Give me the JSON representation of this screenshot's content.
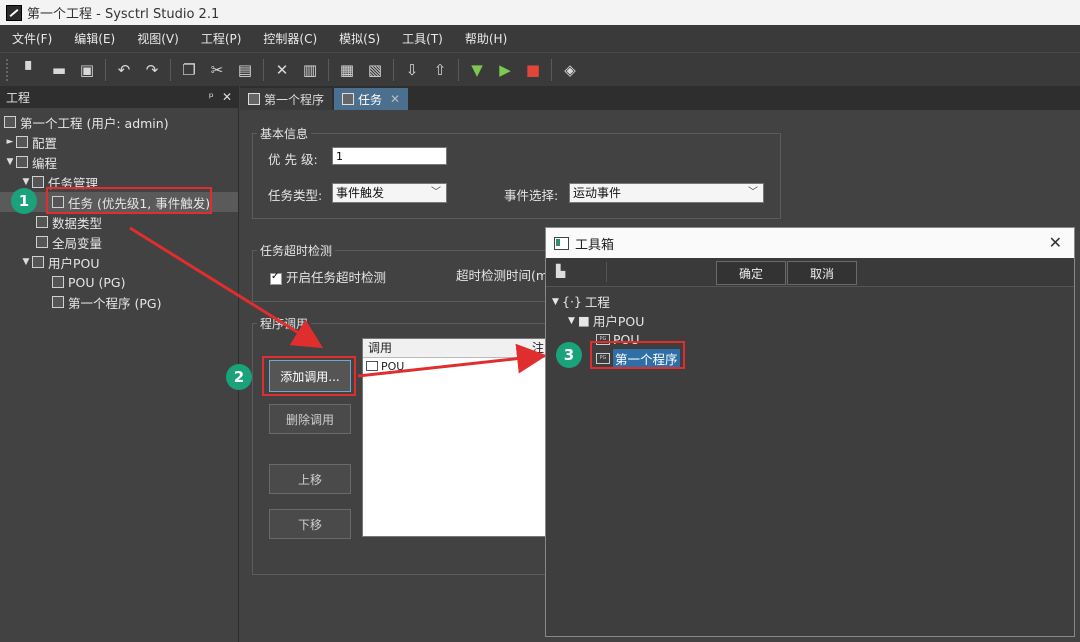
{
  "window": {
    "title": "第一个工程 - Sysctrl Studio 2.1"
  },
  "menu": [
    "文件(F)",
    "编辑(E)",
    "视图(V)",
    "工程(P)",
    "控制器(C)",
    "模拟(S)",
    "工具(T)",
    "帮助(H)"
  ],
  "toolbar": {
    "icons": [
      "new-file-icon",
      "open-folder-icon",
      "save-icon",
      "undo-icon",
      "redo-icon",
      "copy-icon",
      "cut-icon",
      "paste-icon",
      "delete-icon",
      "properties-icon",
      "compile-icon",
      "clear-icon",
      "download-icon",
      "upload-icon",
      "connect-icon",
      "run-icon",
      "stop-icon",
      "debug-icon"
    ]
  },
  "left_panel": {
    "title": "工程",
    "pin": "ᵖ",
    "close": "✕",
    "tree": {
      "root": "第一个工程 (用户: admin)",
      "config": "配置",
      "program": "编程",
      "task_mgmt": "任务管理",
      "task": "任务 (优先级1, 事件触发)",
      "datatype": "数据类型",
      "globals": "全局变量",
      "user_pou": "用户POU",
      "pou": "POU (PG)",
      "first_prog": "第一个程序 (PG)"
    }
  },
  "tabs": [
    {
      "label": "第一个程序"
    },
    {
      "label": "任务",
      "close": "✕"
    }
  ],
  "basic_info": {
    "legend": "基本信息",
    "priority_label": "优 先 级:",
    "priority_value": "1",
    "task_type_label": "任务类型:",
    "task_type_value": "事件触发",
    "event_label": "事件选择:",
    "event_value": "运动事件"
  },
  "timeout": {
    "legend": "任务超时检测",
    "enable_label": "开启任务超时检测",
    "time_label": "超时检测时间(m"
  },
  "program_call": {
    "legend": "程序调用",
    "add_button": "添加调用...",
    "delete_button": "删除调用",
    "up_button": "上移",
    "down_button": "下移",
    "list_header": "调用",
    "list_header2": "注",
    "list_item": "POU"
  },
  "dialog": {
    "title": "工具箱",
    "close": "✕",
    "ok": "确定",
    "cancel": "取消",
    "tree": {
      "project": "工程",
      "user_pou": "用户POU",
      "pou": "POU",
      "first_prog": "第一个程序"
    }
  },
  "annotations": {
    "step1": "1",
    "step2": "2",
    "step3": "3"
  },
  "colors": {
    "annotation_red": "#e02e2e",
    "badge_green": "#1aa37a",
    "selection_blue": "#2f6fa8"
  }
}
